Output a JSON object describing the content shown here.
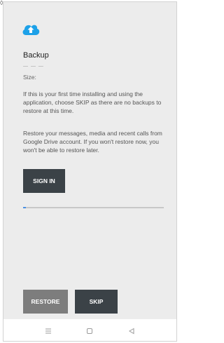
{
  "screen": {
    "corner_mark": "◊",
    "title": "Backup",
    "size_placeholder": "— — —",
    "size_label": "Size:",
    "info_text": "If this is your first time installing and using the application, choose SKIP as there are no backups to restore at this time.",
    "restore_text": "Restore your messages, media and recent calls from Google Drive account. If you won't restore now, you won't be able to restore later.",
    "sign_in_label": "SIGN IN",
    "progress": 0.01,
    "restore_label": "RESTORE",
    "skip_label": "SKIP"
  },
  "icons": {
    "cloud": "cloud-upload-icon",
    "nav_menu": "menu-icon",
    "nav_home": "home-square-icon",
    "nav_back": "back-triangle-icon"
  },
  "colors": {
    "accent": "#1da1e8",
    "button_dark": "#3b4247",
    "button_disabled": "#7d7d7d",
    "background": "#ececec",
    "progress": "#4a90e2"
  }
}
